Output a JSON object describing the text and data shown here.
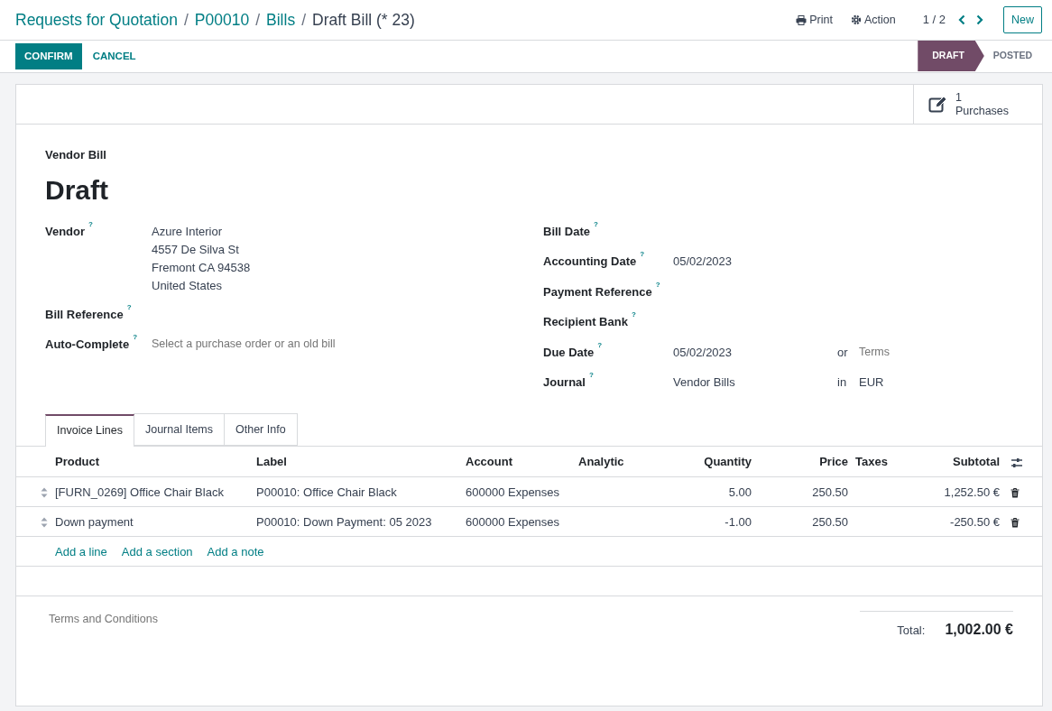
{
  "breadcrumbs": [
    {
      "label": "Requests for Quotation"
    },
    {
      "separator": "/",
      "label": "P00010"
    },
    {
      "separator": "/",
      "label": "Bills"
    },
    {
      "separator": "/",
      "label": "Draft Bill (* 23)"
    }
  ],
  "toolbar": {
    "print": "Print",
    "action": "Action",
    "pager": "1 / 2",
    "new": "New"
  },
  "actions": [
    {
      "label": "CONFIRM",
      "kind": "primary"
    },
    {
      "label": "CANCEL",
      "kind": "link"
    }
  ],
  "stages": [
    {
      "label": "DRAFT",
      "selected": true
    },
    {
      "label": "POSTED",
      "selected": false
    }
  ],
  "smart_button": {
    "count": "1",
    "label": "Purchases"
  },
  "form": {
    "subtitle": "Vendor Bill",
    "title": "Draft",
    "left_fields": [
      {
        "label": "Vendor",
        "help": "?",
        "lines": [
          "Azure Interior",
          "4557 De Silva St",
          "Fremont CA 94538",
          "United States"
        ]
      },
      {
        "label": "Bill Reference",
        "help": "?"
      },
      {
        "label": "Auto-Complete",
        "help": "?",
        "placeholder": "Select a purchase order or an old bill"
      }
    ],
    "right_fields": [
      {
        "label": "Bill Date",
        "help": "?"
      },
      {
        "label": "Accounting Date",
        "help": "?",
        "value": "05/02/2023"
      },
      {
        "label": "Payment Reference",
        "help": "?"
      },
      {
        "label": "Recipient Bank",
        "help": "?"
      },
      {
        "label": "Due Date",
        "help": "?",
        "value": "05/02/2023",
        "joiner": "or",
        "extra_placeholder": "Terms"
      },
      {
        "label": "Journal",
        "help": "?",
        "value": "Vendor Bills",
        "joiner": "in",
        "extra_value": "EUR"
      }
    ]
  },
  "tabs": [
    {
      "label": "Invoice Lines",
      "selected": true
    },
    {
      "label": "Journal Items",
      "selected": false
    },
    {
      "label": "Other Info",
      "selected": false
    }
  ],
  "table": {
    "columns": [
      "Product",
      "Label",
      "Account",
      "Analytic",
      "Quantity",
      "Price",
      "Taxes",
      "Subtotal"
    ],
    "rows": [
      [
        "[FURN_0269] Office Chair Black",
        "P00010: Office Chair Black",
        "600000 Expenses",
        "",
        "5.00",
        "250.50",
        "",
        "1,252.50 €"
      ],
      [
        "Down payment",
        "P00010: Down Payment: 05 2023",
        "600000 Expenses",
        "",
        "-1.00",
        "250.50",
        "",
        "-250.50 €"
      ]
    ],
    "add_links": [
      "Add a line",
      "Add a section",
      "Add a note"
    ]
  },
  "terms_placeholder": "Terms and Conditions",
  "total": {
    "label": "Total:",
    "value": "1,002.00 €"
  }
}
